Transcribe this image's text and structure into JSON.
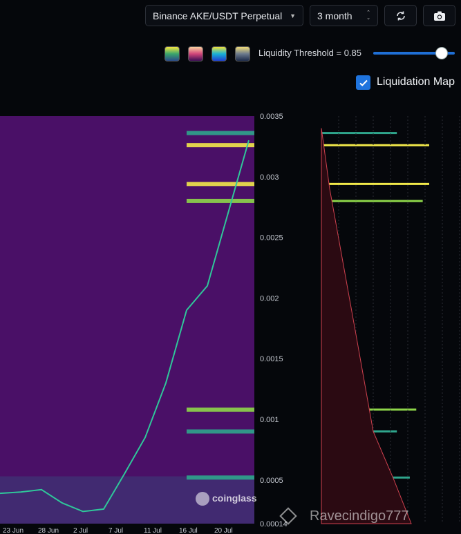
{
  "toolbar": {
    "pair": "Binance AKE/USDT Perpetual",
    "period": "3 month"
  },
  "palette": {
    "swatches": [
      "#3aa66b",
      "#d1457a",
      "#1f3fd1",
      "#6c7a8d"
    ]
  },
  "threshold": {
    "label": "Liquidity Threshold = 0.85",
    "value": 0.85
  },
  "liquidation_map": {
    "label": "Liquidation Map",
    "checked": true
  },
  "watermarks": {
    "coinglass": "coinglass",
    "user": "Ravecindigo777"
  },
  "chart_data": {
    "type": "heatmap",
    "y_ticks": [
      "0.0035",
      "0.003",
      "0.0025",
      "0.002",
      "0.0015",
      "0.001",
      "0.0005",
      "0.00014"
    ],
    "x_ticks": [
      "23 Jun",
      "28 Jun",
      "2 Jul",
      "7 Jul",
      "11 Jul",
      "16 Jul",
      "20 Jul"
    ],
    "ylim": [
      0.00014,
      0.0035
    ],
    "price_close": [
      0.00039,
      0.0004,
      0.00042,
      0.00031,
      0.00024,
      0.00026,
      0.00055,
      0.00085,
      0.0013,
      0.0019,
      0.0021,
      0.0027,
      0.0033
    ],
    "liquidity_bands": [
      {
        "price": 0.00336,
        "strength": 0.5
      },
      {
        "price": 0.00326,
        "strength": 1.0
      },
      {
        "price": 0.00294,
        "strength": 1.0
      },
      {
        "price": 0.0028,
        "strength": 0.9
      },
      {
        "price": 0.00108,
        "strength": 0.8
      },
      {
        "price": 0.0009,
        "strength": 0.5
      },
      {
        "price": 0.00052,
        "strength": 0.7
      }
    ]
  }
}
